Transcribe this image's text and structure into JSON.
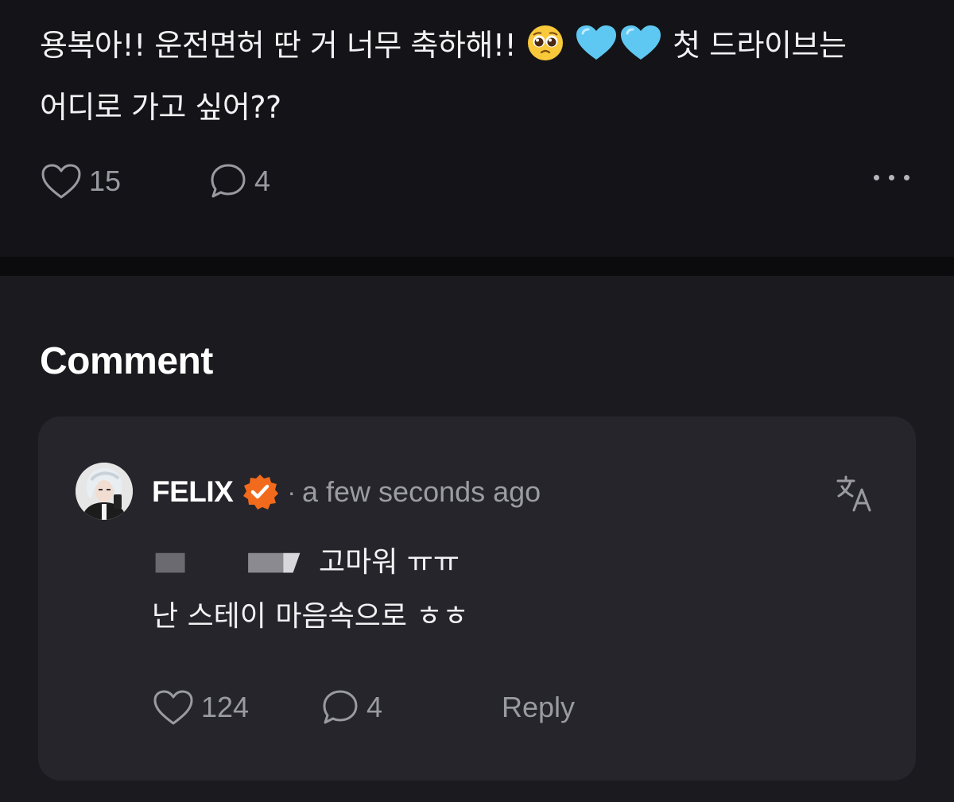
{
  "post": {
    "text_before_emoji": "용복아!! 운전면허 딴 거 너무 축하해!!",
    "text_after_emoji": "첫 드라이브는",
    "text_line2": "어디로 가고 싶어??",
    "emojis": [
      "pleading-face",
      "light-blue-heart",
      "light-blue-heart"
    ],
    "likes": "15",
    "comments": "4"
  },
  "comment_section": {
    "title": "Comment",
    "comment": {
      "author": "FELIX",
      "meta_separator": "·",
      "timestamp": "a few seconds ago",
      "body_line1": "고마워 ㅠㅠ",
      "body_line2": "난 스테이 마음속으로 ㅎㅎ",
      "likes": "124",
      "replies": "4",
      "reply_label": "Reply"
    }
  },
  "colors": {
    "background": "#141418",
    "card": "#25252b",
    "muted_text": "#9a9aa2",
    "verified_badge": "#f26a1b",
    "heart_emoji": "#5ec8f2"
  }
}
